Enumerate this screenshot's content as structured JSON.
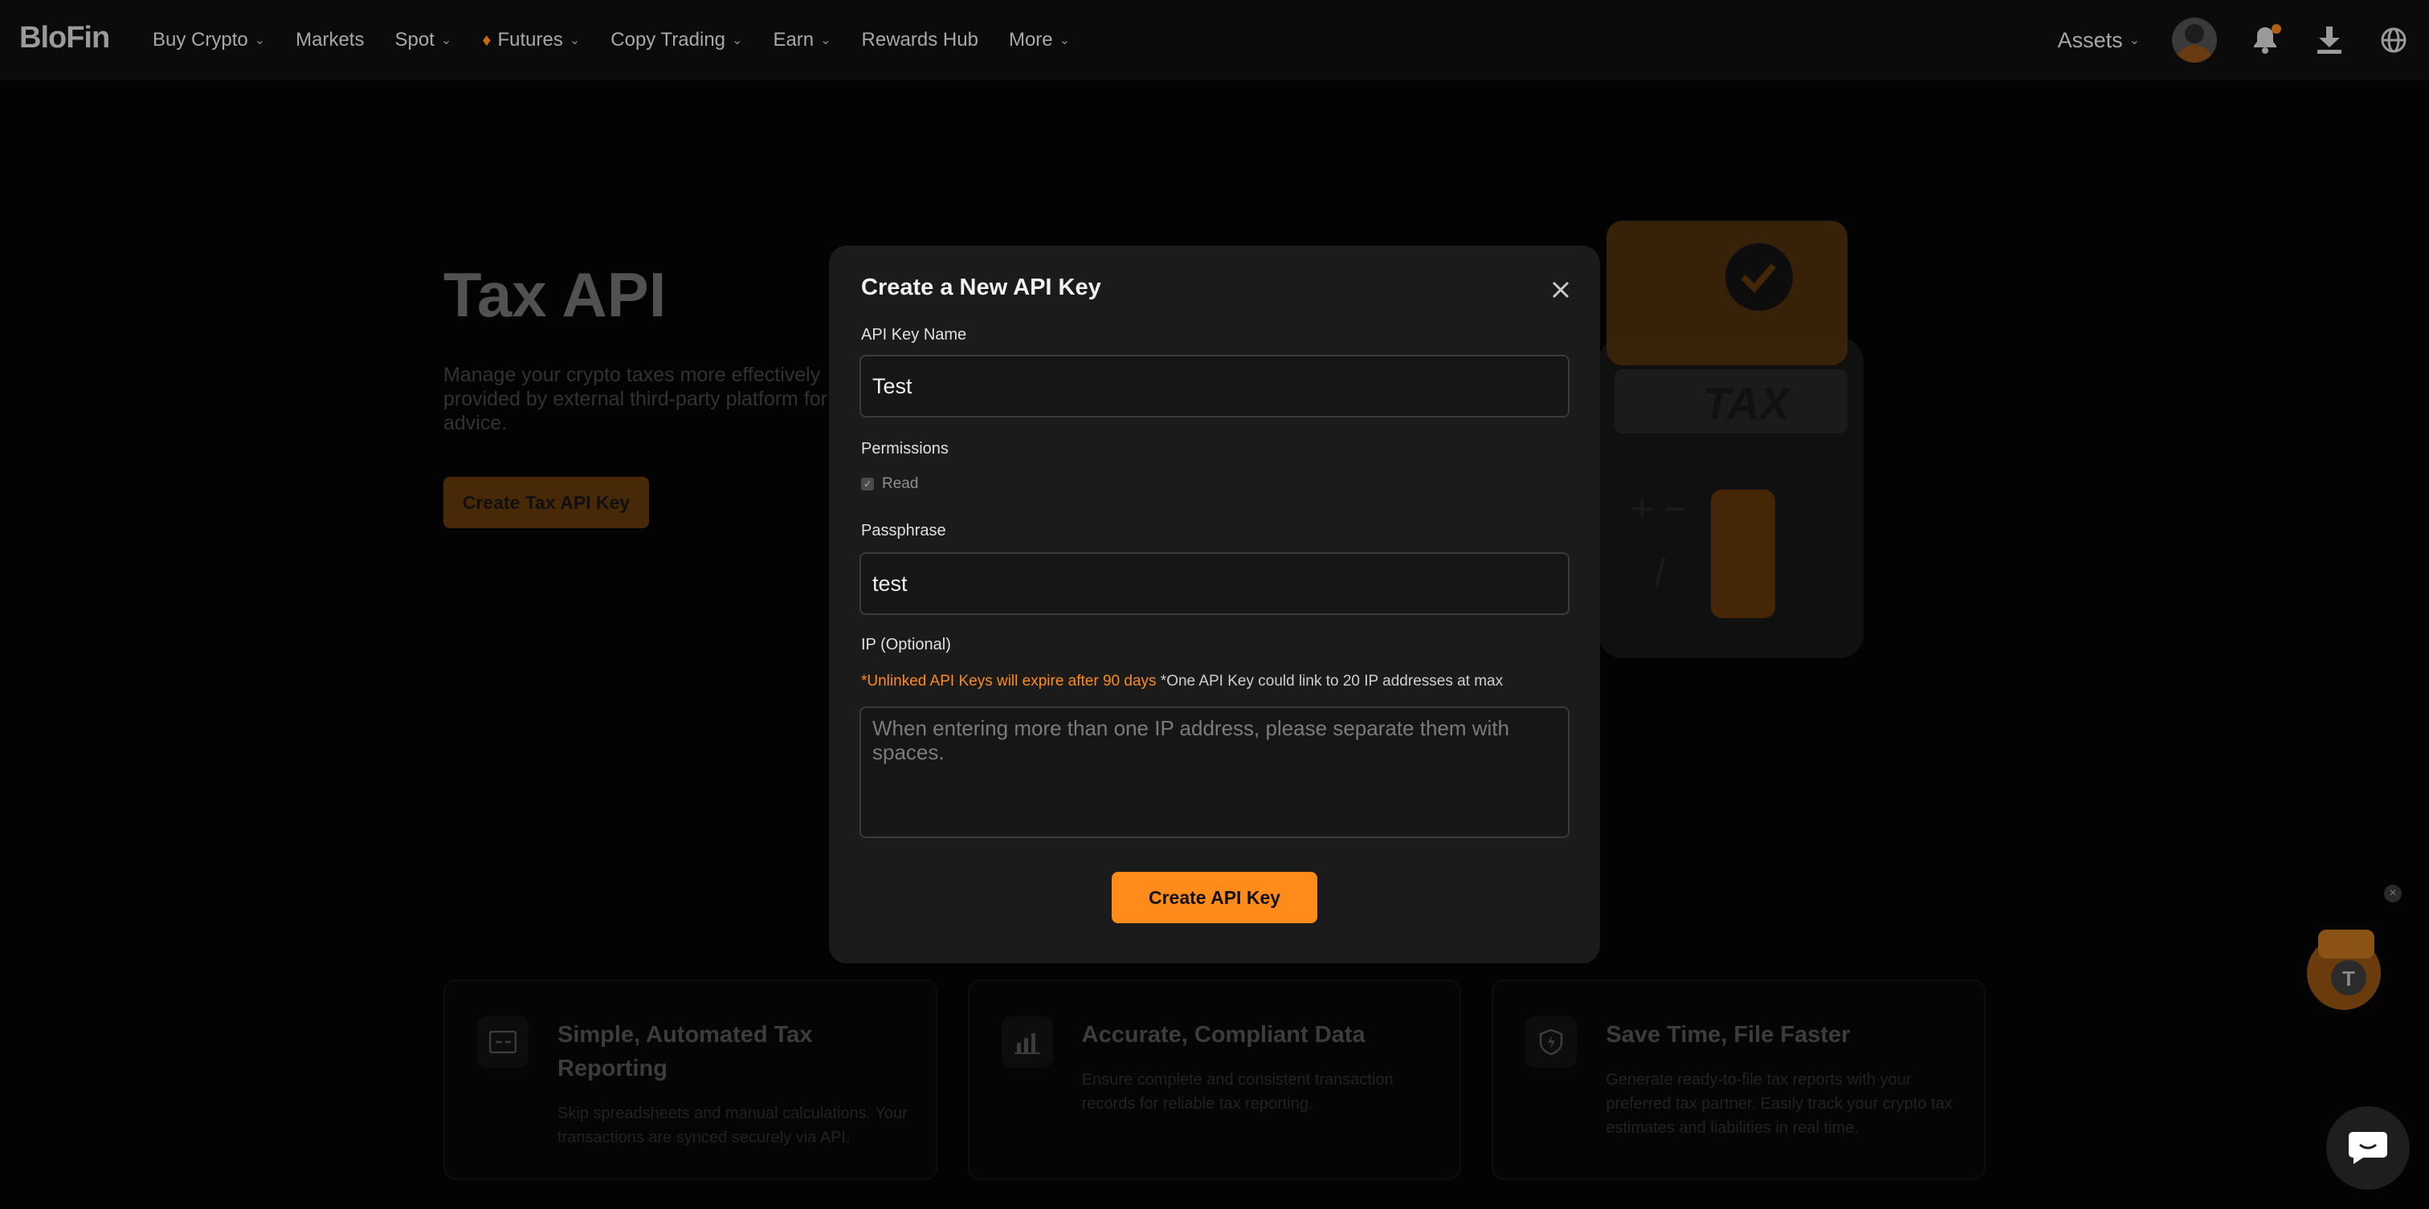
{
  "nav": {
    "logo": "BloFin",
    "items": [
      {
        "label": "Buy Crypto",
        "has_dropdown": true
      },
      {
        "label": "Markets",
        "has_dropdown": false
      },
      {
        "label": "Spot",
        "has_dropdown": true
      },
      {
        "label": "Futures",
        "has_dropdown": true,
        "icon": "flame-icon"
      },
      {
        "label": "Copy Trading",
        "has_dropdown": true
      },
      {
        "label": "Earn",
        "has_dropdown": true
      },
      {
        "label": "Rewards Hub",
        "has_dropdown": false
      },
      {
        "label": "More",
        "has_dropdown": true
      }
    ],
    "assets_label": "Assets",
    "icons": [
      "avatar",
      "bell-icon",
      "download-icon",
      "globe-icon"
    ]
  },
  "hero": {
    "title": "Tax API",
    "description": "Manage your crypto taxes more effectively provided by external third-party platform for advice.",
    "button_label": "Create Tax API Key"
  },
  "features": [
    {
      "icon": "report-icon",
      "title": "Simple, Automated Tax Reporting",
      "description": "Skip spreadsheets and manual calculations. Your transactions are synced securely via API."
    },
    {
      "icon": "chart-icon",
      "title": "Accurate, Compliant Data",
      "description": "Ensure complete and consistent transaction records for reliable tax reporting."
    },
    {
      "icon": "shield-bolt-icon",
      "title": "Save Time, File Faster",
      "description": "Generate ready-to-file tax reports with your preferred tax partner. Easily track your crypto tax estimates and liabilities in real time."
    }
  ],
  "modal": {
    "title": "Create a New API Key",
    "name_label": "API Key Name",
    "name_value": "Test",
    "permissions_label": "Permissions",
    "permission_read": "Read",
    "passphrase_label": "Passphrase",
    "passphrase_value": "test",
    "ip_label": "IP (Optional)",
    "note_warning": "*Unlinked API Keys will expire after 90 days",
    "note_info": "*One API Key could link to 20 IP addresses at max",
    "ip_placeholder": "When entering more than one IP address, please separate them with spaces.",
    "submit_label": "Create API Key"
  },
  "colors": {
    "accent": "#ff8c1a",
    "warning_text": "#ff8a1e",
    "modal_bg": "#1b1b1b",
    "page_bg": "#050505"
  }
}
